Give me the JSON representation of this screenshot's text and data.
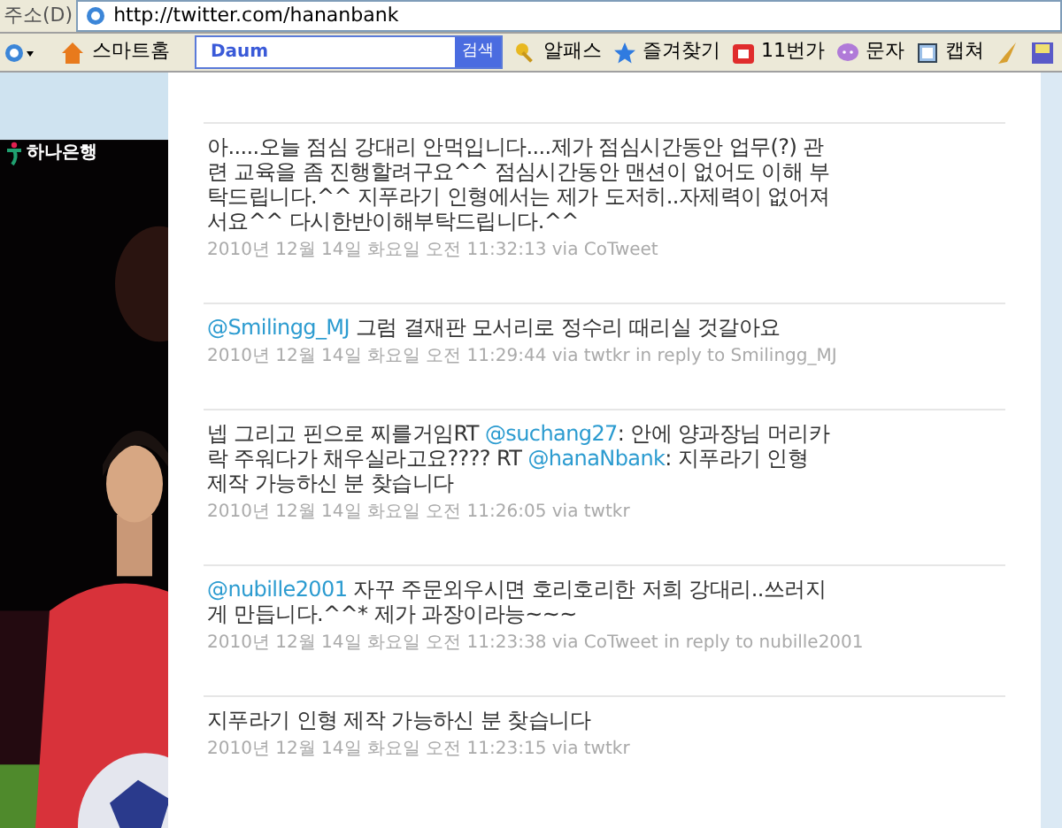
{
  "address_bar": {
    "label": "주소(D)",
    "url": "http://twitter.com/hananbank"
  },
  "toolbar": {
    "home": "스마트홈",
    "search": {
      "logo": "Daum",
      "button": "검색"
    },
    "items": [
      {
        "kind": "key",
        "label": "알패스"
      },
      {
        "kind": "star",
        "label": "즐겨찾기"
      },
      {
        "kind": "shop",
        "label": "11번가"
      },
      {
        "kind": "bubble",
        "label": "문자"
      },
      {
        "kind": "capture",
        "label": "캡쳐"
      }
    ]
  },
  "sidebar": {
    "logo": "하나은행"
  },
  "tweets": [
    {
      "parts": [
        {
          "text": "아.....오늘 점심 강대리 안먹입니다....제가 점심시간동안 업무(?) 관련 교육을 좀 진행할려구요^^ 점심시간동안 맨션이 없어도 이해 부탁드립니다.^^ 지푸라기 인형에서는 제가 도저히..자제력이 없어져서요^^ 다시한반이해부탁드립니다.^^",
          "kind": "text"
        }
      ],
      "meta": "2010년 12월 14일 화요일 오전 11:32:13 via CoTweet"
    },
    {
      "parts": [
        {
          "text": "@Smilingg_MJ",
          "kind": "mention"
        },
        {
          "text": " 그럼 결재판 모서리로 정수리 때리실 것갈아요",
          "kind": "text"
        }
      ],
      "meta": "2010년 12월 14일 화요일 오전 11:29:44 via twtkr in reply to Smilingg_MJ"
    },
    {
      "parts": [
        {
          "text": "넵 그리고 핀으로 찌를거임RT ",
          "kind": "text"
        },
        {
          "text": "@suchang27",
          "kind": "mention"
        },
        {
          "text": ": 안에 양과장님 머리카락 주워다가 채우실라고요???? RT ",
          "kind": "text"
        },
        {
          "text": "@hanaNbank",
          "kind": "mention"
        },
        {
          "text": ": 지푸라기 인형 제작 가능하신 분 찾습니다",
          "kind": "text"
        }
      ],
      "meta": "2010년 12월 14일 화요일 오전 11:26:05 via twtkr"
    },
    {
      "parts": [
        {
          "text": "@nubille2001",
          "kind": "mention"
        },
        {
          "text": " 자꾸 주문외우시면 호리호리한 저희 강대리..쓰러지게 만듭니다.^^* 제가 과장이라능~~~",
          "kind": "text"
        }
      ],
      "meta": "2010년 12월 14일 화요일 오전 11:23:38 via CoTweet in reply to nubille2001"
    },
    {
      "parts": [
        {
          "text": "지푸라기 인형 제작 가능하신 분 찾습니다",
          "kind": "text"
        }
      ],
      "meta": "2010년 12월 14일 화요일 오전 11:23:15 via twtkr"
    }
  ]
}
